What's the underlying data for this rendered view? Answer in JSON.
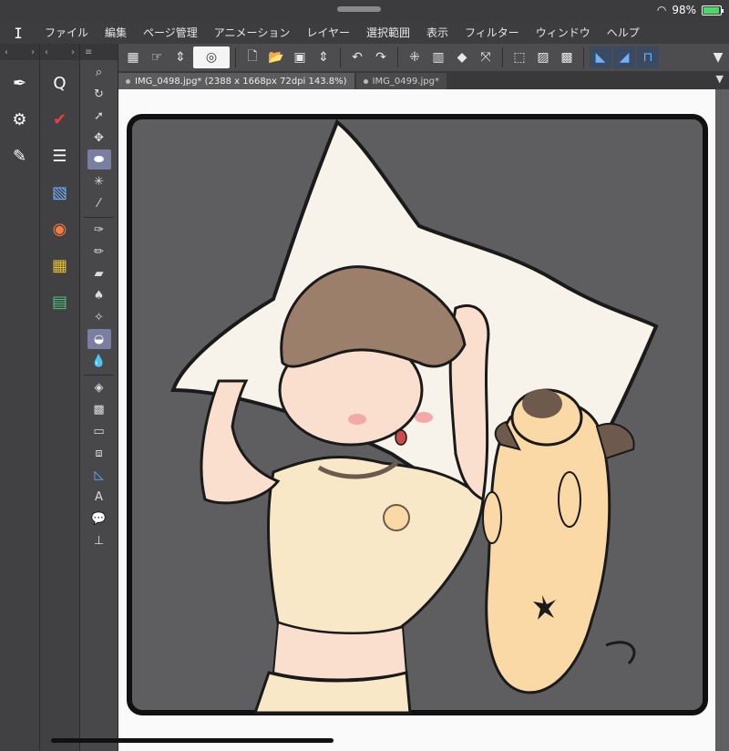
{
  "status": {
    "battery": "98%"
  },
  "menu": [
    "ファイル",
    "編集",
    "ページ管理",
    "アニメーション",
    "レイヤー",
    "選択範囲",
    "表示",
    "フィルター",
    "ウィンドウ",
    "ヘルプ"
  ],
  "tabs": [
    {
      "label": "IMG_0498.jpg* (2388 x 1668px 72dpi 143.8%)"
    },
    {
      "label": "IMG_0499.jpg*"
    }
  ],
  "colors": {
    "background": "#5a5a5c",
    "canvas_bg": "#5e5e60",
    "frame": "#111111",
    "pillow": "#f7f2ea",
    "hair": "#9b7f6b",
    "skin": "#fadfce",
    "shirt": "#f9e8c8",
    "pug": "#fad9a6",
    "pug_dark": "#6e5a4c"
  }
}
